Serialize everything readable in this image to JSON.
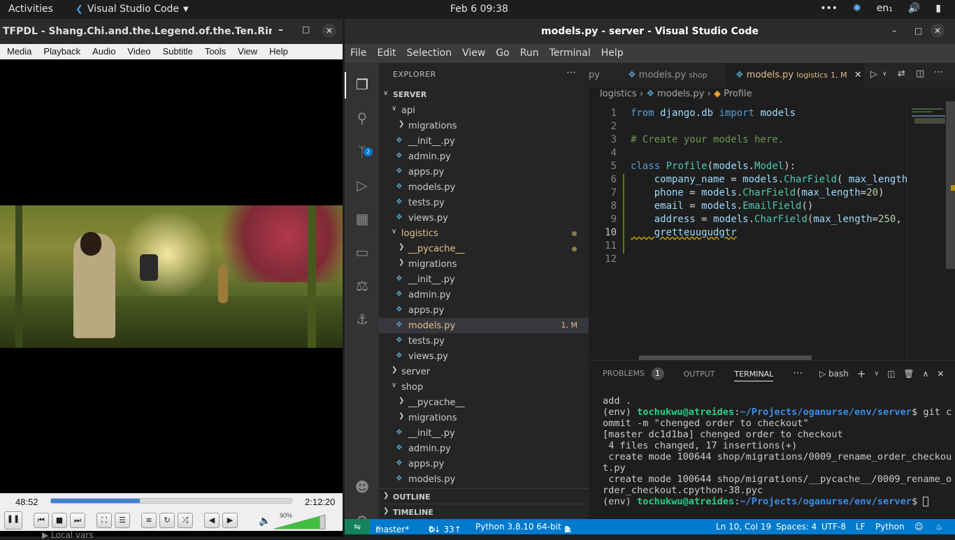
{
  "topbar": {
    "activities": "Activities",
    "app_name": "Visual Studio Code",
    "clock": "Feb 6  09:38",
    "input_lang": "en₁"
  },
  "vlc": {
    "title": "TFPDL - Shang.Chi.and.the.Legend.of.the.Ten.Rings....",
    "menu": [
      "Media",
      "Playback",
      "Audio",
      "Video",
      "Subtitle",
      "Tools",
      "View",
      "Help"
    ],
    "elapsed": "48:52",
    "duration": "2:12:20",
    "progress": 0.37,
    "volume_label": "90%",
    "volume": 0.9,
    "below_text": "Local vars"
  },
  "vscode": {
    "title": "models.py - server - Visual Studio Code",
    "menu": [
      "File",
      "Edit",
      "Selection",
      "View",
      "Go",
      "Run",
      "Terminal",
      "Help"
    ],
    "explorer_title": "EXPLORER",
    "root": "SERVER",
    "tree": [
      {
        "label": "api",
        "type": "folder-open",
        "indent": 1
      },
      {
        "label": "migrations",
        "type": "folder",
        "indent": 2
      },
      {
        "label": "__init__.py",
        "type": "py",
        "indent": 2
      },
      {
        "label": "admin.py",
        "type": "py",
        "indent": 2
      },
      {
        "label": "apps.py",
        "type": "py",
        "indent": 2
      },
      {
        "label": "models.py",
        "type": "py",
        "indent": 2
      },
      {
        "label": "tests.py",
        "type": "py",
        "indent": 2
      },
      {
        "label": "views.py",
        "type": "py",
        "indent": 2
      },
      {
        "label": "logistics",
        "type": "folder-open",
        "indent": 1,
        "modified": true
      },
      {
        "label": "__pycache__",
        "type": "folder",
        "indent": 2,
        "modified": true
      },
      {
        "label": "migrations",
        "type": "folder",
        "indent": 2
      },
      {
        "label": "__init__.py",
        "type": "py",
        "indent": 2
      },
      {
        "label": "admin.py",
        "type": "py",
        "indent": 2
      },
      {
        "label": "apps.py",
        "type": "py",
        "indent": 2
      },
      {
        "label": "models.py",
        "type": "py",
        "indent": 2,
        "selected": true,
        "badge": "1, M"
      },
      {
        "label": "tests.py",
        "type": "py",
        "indent": 2
      },
      {
        "label": "views.py",
        "type": "py",
        "indent": 2
      },
      {
        "label": "server",
        "type": "folder",
        "indent": 1
      },
      {
        "label": "shop",
        "type": "folder-open",
        "indent": 1
      },
      {
        "label": "__pycache__",
        "type": "folder",
        "indent": 2
      },
      {
        "label": "migrations",
        "type": "folder",
        "indent": 2
      },
      {
        "label": "__init__.py",
        "type": "py",
        "indent": 2
      },
      {
        "label": "admin.py",
        "type": "py",
        "indent": 2
      },
      {
        "label": "apps.py",
        "type": "py",
        "indent": 2
      },
      {
        "label": "models.py",
        "type": "py",
        "indent": 2
      }
    ],
    "outline": "OUTLINE",
    "timeline": "TIMELINE",
    "tabs": [
      {
        "name": "py",
        "dir": ""
      },
      {
        "name": "models.py",
        "dir": "shop"
      },
      {
        "name": "models.py",
        "dir": "logistics",
        "badge": "1, M"
      }
    ],
    "breadcrumb": [
      "logistics",
      "models.py",
      "Profile"
    ],
    "code": [
      "from django.db import models",
      "",
      "# Create your models here.",
      "",
      "class Profile(models.Model):",
      "    company_name = models.CharField( max_length",
      "    phone = models.CharField(max_length=20)",
      "    email = models.EmailField()",
      "    address = models.CharField(max_length=250,",
      "    gretteuugudgtr",
      "",
      ""
    ],
    "panel_tabs": [
      "PROBLEMS",
      "OUTPUT",
      "TERMINAL"
    ],
    "problems_count": "1",
    "terminal_shell": "bash",
    "terminal": {
      "l1": "add .",
      "env": "(env) ",
      "user": "tochukwu@atreides",
      "colon": ":",
      "path": "~/Projects/oganurse/env/server",
      "cmd1": "$ git commit -m \"chenged order to checkout\"",
      "l3": "[master dc1d1ba] chenged order to checkout",
      "l4": " 4 files changed, 17 insertions(+)",
      "l5": " create mode 100644 shop/migrations/0009_rename_order_checkout.py",
      "l6": " create mode 100644 shop/migrations/__pycache__/0009_rename_order_checkout.cpython-38.pyc",
      "prompt_end": "$ "
    },
    "status": {
      "branch": "master*",
      "sync": "0↓ 33↑",
      "python": "Python 3.8.10 64-bit",
      "errors": "0",
      "warnings": "1",
      "position": "Ln 10, Col 19",
      "spaces": "Spaces: 4",
      "encoding": "UTF-8",
      "eol": "LF",
      "language": "Python"
    },
    "scm_badge": "2"
  }
}
